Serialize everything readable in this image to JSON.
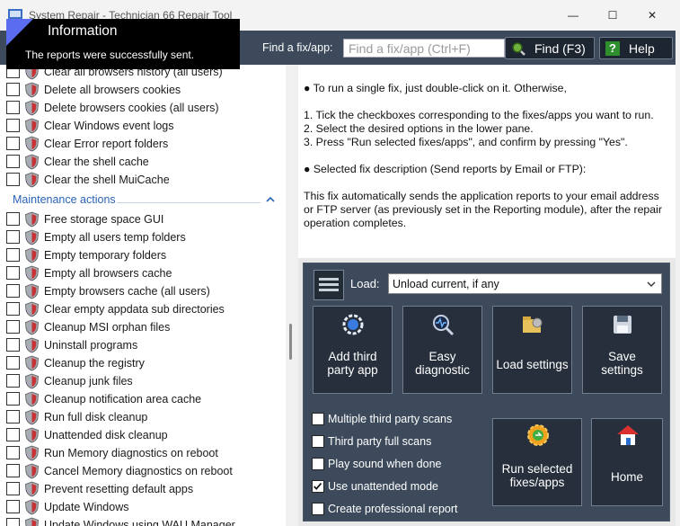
{
  "window": {
    "title": "System Repair - Technician 66 Repair Tool",
    "minimize_glyph": "—",
    "maximize_glyph": "☐",
    "close_glyph": "✕"
  },
  "toolbar": {
    "find_label": "Find a fix/app:",
    "search_placeholder": "Find a fix/app (Ctrl+F)",
    "find_button": "Find (F3)",
    "help_button": "Help",
    "help_glyph": "?"
  },
  "notification": {
    "title": "Information",
    "message": "The reports were successfully sent."
  },
  "fix_list": {
    "top_items": [
      {
        "label": "Clear all browsers history (all users)",
        "checked": false
      },
      {
        "label": "Delete all browsers cookies",
        "checked": false
      },
      {
        "label": "Delete browsers cookies (all users)",
        "checked": false
      },
      {
        "label": "Clear Windows event logs",
        "checked": false
      },
      {
        "label": "Clear Error report folders",
        "checked": false
      },
      {
        "label": "Clear the shell cache",
        "checked": false
      },
      {
        "label": "Clear the shell MuiCache",
        "checked": false
      }
    ],
    "section_title": "Maintenance actions",
    "section_items": [
      {
        "label": "Free storage space GUI",
        "checked": false
      },
      {
        "label": "Empty all users temp folders",
        "checked": false
      },
      {
        "label": "Empty temporary folders",
        "checked": false
      },
      {
        "label": "Empty all browsers cache",
        "checked": false
      },
      {
        "label": "Empty browsers cache (all users)",
        "checked": false
      },
      {
        "label": "Clear empty appdata sub directories",
        "checked": false
      },
      {
        "label": "Cleanup MSI orphan files",
        "checked": false
      },
      {
        "label": "Uninstall programs",
        "checked": false
      },
      {
        "label": "Cleanup the registry",
        "checked": false
      },
      {
        "label": "Cleanup junk files",
        "checked": false
      },
      {
        "label": "Cleanup notification area cache",
        "checked": false
      },
      {
        "label": "Run full disk cleanup",
        "checked": false
      },
      {
        "label": "Unattended disk cleanup",
        "checked": false
      },
      {
        "label": "Run Memory diagnostics on reboot",
        "checked": false
      },
      {
        "label": "Cancel Memory diagnostics on reboot",
        "checked": false
      },
      {
        "label": "Prevent resetting default apps",
        "checked": false
      },
      {
        "label": "Update Windows",
        "checked": false
      },
      {
        "label": "Update Windows using WAU Manager",
        "checked": false
      }
    ]
  },
  "description": {
    "lines": [
      "● To run a single fix, just double-click on it. Otherwise,",
      "1. Tick the checkboxes corresponding to the fixes/apps you want to run.",
      "2. Select the desired options in the lower pane.",
      "3. Press \"Run selected fixes/apps\", and confirm by pressing \"Yes\".",
      "● Selected fix description (Send reports by Email or FTP):",
      "This fix automatically sends the application reports to your email address",
      "or FTP server (as previously set in the Reporting module), after the repair",
      "operation completes."
    ]
  },
  "panel": {
    "load_label": "Load:",
    "load_value": "Unload current, if any",
    "buttons": {
      "add_third_party": [
        "Add third",
        "party app"
      ],
      "easy_diagnostic": [
        "Easy",
        "diagnostic"
      ],
      "load_settings": [
        "Load settings"
      ],
      "save_settings": [
        "Save",
        "settings"
      ],
      "run_selected": [
        "Run selected",
        "fixes/apps"
      ],
      "home": [
        "Home"
      ]
    },
    "options": [
      {
        "label": "Multiple third party scans",
        "checked": false
      },
      {
        "label": "Third party full scans",
        "checked": false
      },
      {
        "label": "Play sound when done",
        "checked": false
      },
      {
        "label": "Use unattended mode",
        "checked": true
      },
      {
        "label": "Create professional report",
        "checked": false
      }
    ]
  },
  "colors": {
    "toolbar_bg": "#3c4a5b",
    "section_title": "#2a63b8",
    "button_bg": "#262f3b",
    "popup_bg": "#000000",
    "accent_triangle": "#5b6cf0"
  },
  "icons": {
    "fix_item": "shield-icon",
    "find": "magnifier-icon",
    "help": "question-icon",
    "menu": "hamburger-icon"
  }
}
